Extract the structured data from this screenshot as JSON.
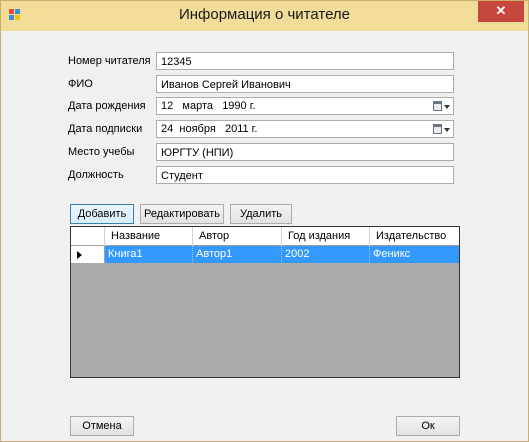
{
  "window": {
    "title": "Информация о читателе",
    "close_glyph": "✕"
  },
  "form": {
    "reader_number": {
      "label": "Номер читателя",
      "value": "12345"
    },
    "full_name": {
      "label": "ФИО",
      "value": "Иванов Сергей Иванович"
    },
    "birth_date": {
      "label": "Дата рождения",
      "day": "12",
      "month": "марта",
      "year": "1990 г."
    },
    "subscription_date": {
      "label": "Дата подписки",
      "day": "24",
      "month": "ноября",
      "year": "2011 г."
    },
    "place_of_study": {
      "label": "Место учебы",
      "value": "ЮРГТУ (НПИ)"
    },
    "position": {
      "label": "Должность",
      "value": "Студент"
    }
  },
  "toolbar": {
    "add_label": "Добавить",
    "edit_label": "Редактировать",
    "delete_label": "Удалить"
  },
  "table": {
    "columns": [
      "Название",
      "Автор",
      "Год издания",
      "Издательство"
    ],
    "rows": [
      [
        "Книга1",
        "Автор1",
        "2002",
        "Феникс"
      ]
    ],
    "selected_row": 0,
    "selection_color": "#3399ff"
  },
  "footer": {
    "cancel_label": "Отмена",
    "ok_label": "Ок"
  }
}
